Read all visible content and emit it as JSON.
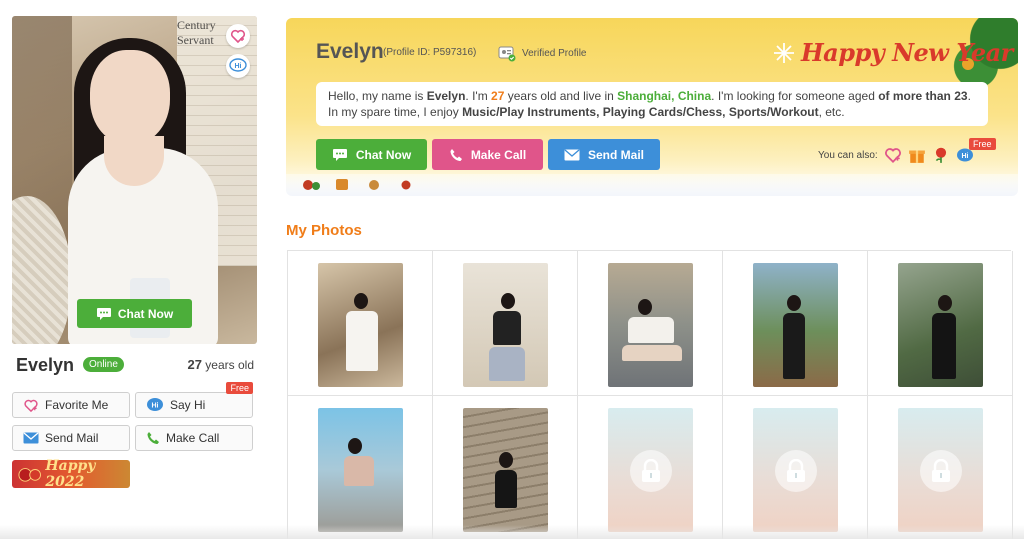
{
  "profile": {
    "name": "Evelyn",
    "status": "Online",
    "age_number": "27",
    "age_suffix": " years old",
    "profile_id": "(Profile ID: P597316)",
    "verified_label": "Verified Profile"
  },
  "main_photo": {
    "chat_now_label": "Chat Now",
    "newspaper_text": "Century Servant"
  },
  "left_actions": {
    "favorite_label": "Favorite Me",
    "say_hi_label": "Say Hi",
    "free_tag": "Free",
    "send_mail_label": "Send Mail",
    "make_call_label": "Make Call",
    "happy_badge_label": "Happy 2022"
  },
  "header": {
    "banner_text": "Happy New Year",
    "intro": {
      "p1": "Hello, my name is ",
      "name": "Evelyn",
      "p2": ". I'm ",
      "age": "27",
      "p3": " years old and live in ",
      "city": "Shanghai",
      "comma": ", ",
      "country": "China",
      "p4": ". I'm looking for someone aged ",
      "aged": "of more than 23",
      "p5": ". In my spare time, I enjoy ",
      "hobbies": "Music/Play Instruments, Playing Cards/Chess, Sports/Workout",
      "p6": ", etc."
    },
    "chat_now_label": "Chat Now",
    "make_call_label": "Make Call",
    "send_mail_label": "Send Mail",
    "you_can_also": "You can also:",
    "free_tag": "Free"
  },
  "photos": {
    "title": "My Photos"
  },
  "colors": {
    "green": "#4cae3a",
    "pink": "#e0558a",
    "blue": "#3d8fd9",
    "orange": "#f07d19",
    "red": "#e94b3c"
  }
}
